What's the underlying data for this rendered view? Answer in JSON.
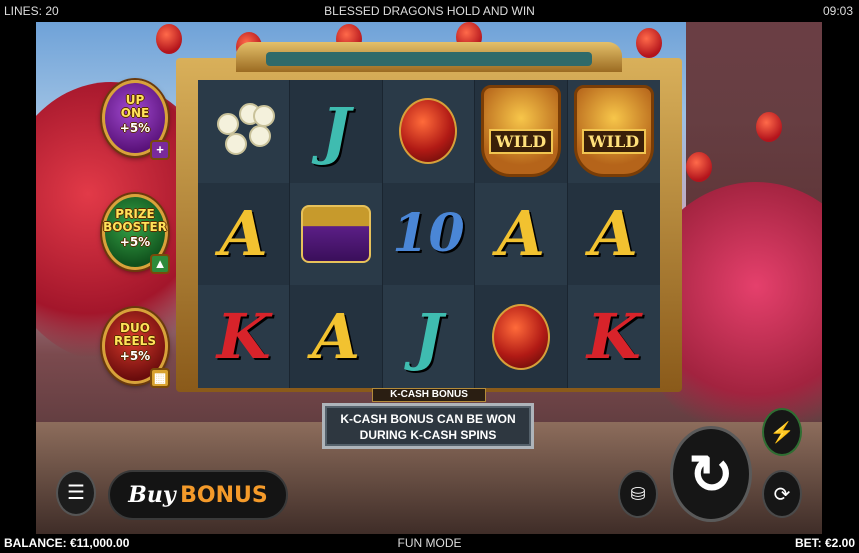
{
  "topbar": {
    "lines": "LINES: 20",
    "title": "BLESSED DRAGONS HOLD AND WIN",
    "time": "09:03"
  },
  "features": [
    {
      "name": "up-one",
      "line1": "UP",
      "line2": "ONE",
      "pct": "+5%",
      "color": "#7a2a9a",
      "badge": "+"
    },
    {
      "name": "prize-booster",
      "line1": "PRIZE",
      "line2": "BOOSTER",
      "pct": "+5%",
      "color": "#1f7a2e",
      "badge": "▲"
    },
    {
      "name": "duo-reels",
      "line1": "DUO",
      "line2": "REELS",
      "pct": "+5%",
      "color": "#b31f22",
      "badge": "▦"
    }
  ],
  "reels": {
    "grid": [
      [
        "flower",
        "J",
        "lantern",
        "wild",
        "wild"
      ],
      [
        "A",
        "chest",
        "10",
        "A",
        "A"
      ],
      [
        "K",
        "A",
        "J",
        "lantern",
        "K"
      ]
    ],
    "wild_label": "WILD"
  },
  "kcash": {
    "title": "K-CASH BONUS",
    "line1": "K-CASH BONUS CAN BE WON",
    "line2": "DURING K-CASH SPINS"
  },
  "controls": {
    "menu_icon": "☰",
    "buy_word": "Buy",
    "bonus_word": "BONUS",
    "spin_icon": "↻",
    "stake_icon": "⛁",
    "turbo_icon": "⚡",
    "auto_icon": "⟳"
  },
  "bottombar": {
    "balance": "BALANCE: €11,000.00",
    "mode": "FUN MODE",
    "bet": "BET: €2.00"
  }
}
